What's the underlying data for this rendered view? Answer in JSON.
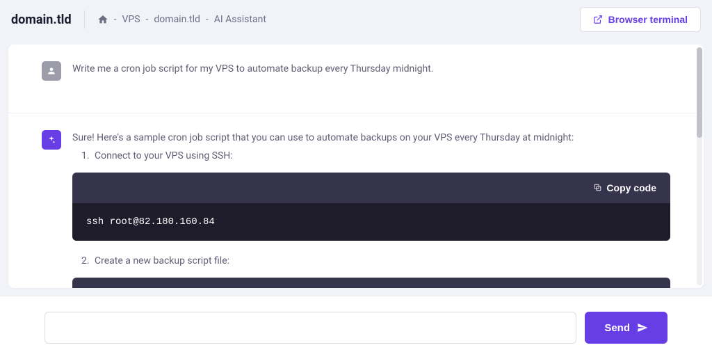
{
  "header": {
    "domain": "domain.tld",
    "breadcrumb": {
      "vps": "VPS",
      "domain": "domain.tld",
      "page": "AI Assistant"
    },
    "terminal_button": "Browser terminal"
  },
  "chat": {
    "user_message": "Write me a cron job script for my VPS to automate backup every Thursday midnight.",
    "ai_intro": "Sure! Here's a sample cron job script that you can use to automate backups on your VPS every Thursday at midnight:",
    "steps": {
      "step1": "Connect to your VPS using SSH:",
      "step2": "Create a new backup script file:"
    },
    "code1": "ssh root@82.180.160.84",
    "copy_label": "Copy code"
  },
  "input": {
    "placeholder": "",
    "send_label": "Send"
  }
}
